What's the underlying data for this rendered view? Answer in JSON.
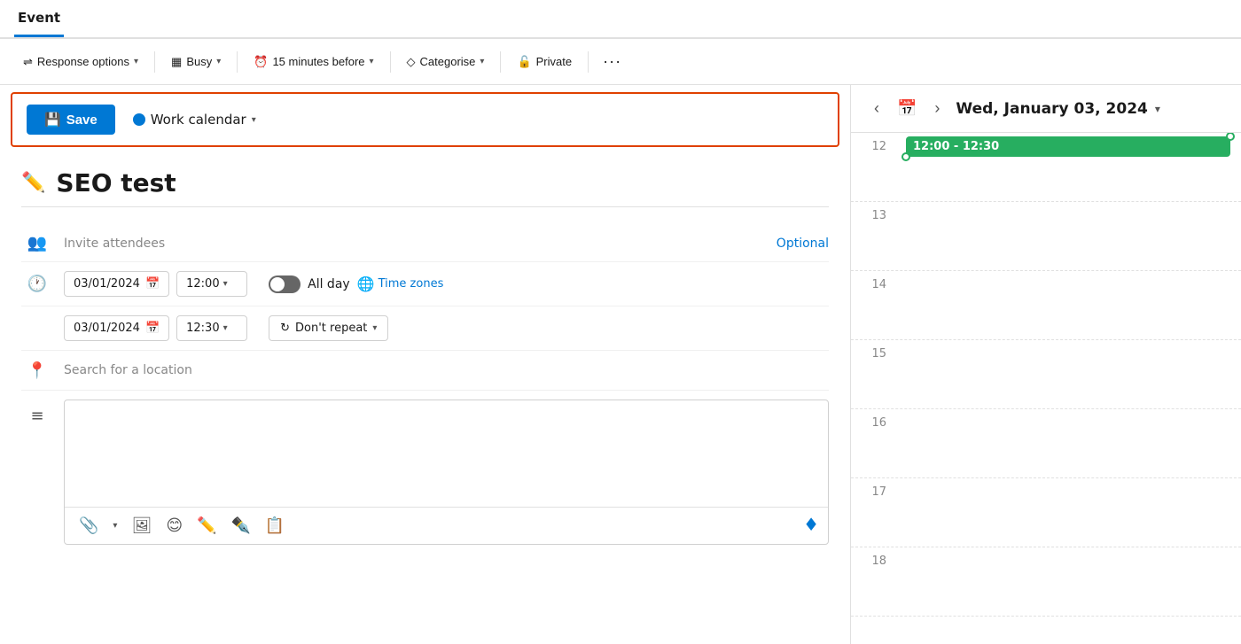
{
  "tabs": {
    "active": "Event"
  },
  "toolbar": {
    "response_options": "Response options",
    "busy": "Busy",
    "reminder": "15 minutes before",
    "categorise": "Categorise",
    "private": "Private"
  },
  "action_bar": {
    "save_label": "Save",
    "calendar_name": "Work calendar"
  },
  "form": {
    "event_title": "SEO test",
    "invite_attendees_placeholder": "Invite attendees",
    "optional_label": "Optional",
    "start_date": "03/01/2024",
    "start_time": "12:00",
    "end_date": "03/01/2024",
    "end_time": "12:30",
    "all_day_label": "All day",
    "time_zones_label": "Time zones",
    "dont_repeat_label": "Don't repeat",
    "location_placeholder": "Search for a location"
  },
  "calendar": {
    "date_title": "Wed, January 03, 2024",
    "event_label": "12:00 - 12:30",
    "hours": [
      {
        "label": "12",
        "has_event": true
      },
      {
        "label": "13",
        "has_event": false
      },
      {
        "label": "14",
        "has_event": false
      },
      {
        "label": "15",
        "has_event": false
      },
      {
        "label": "16",
        "has_event": false
      },
      {
        "label": "17",
        "has_event": false
      },
      {
        "label": "18",
        "has_event": false
      }
    ]
  }
}
